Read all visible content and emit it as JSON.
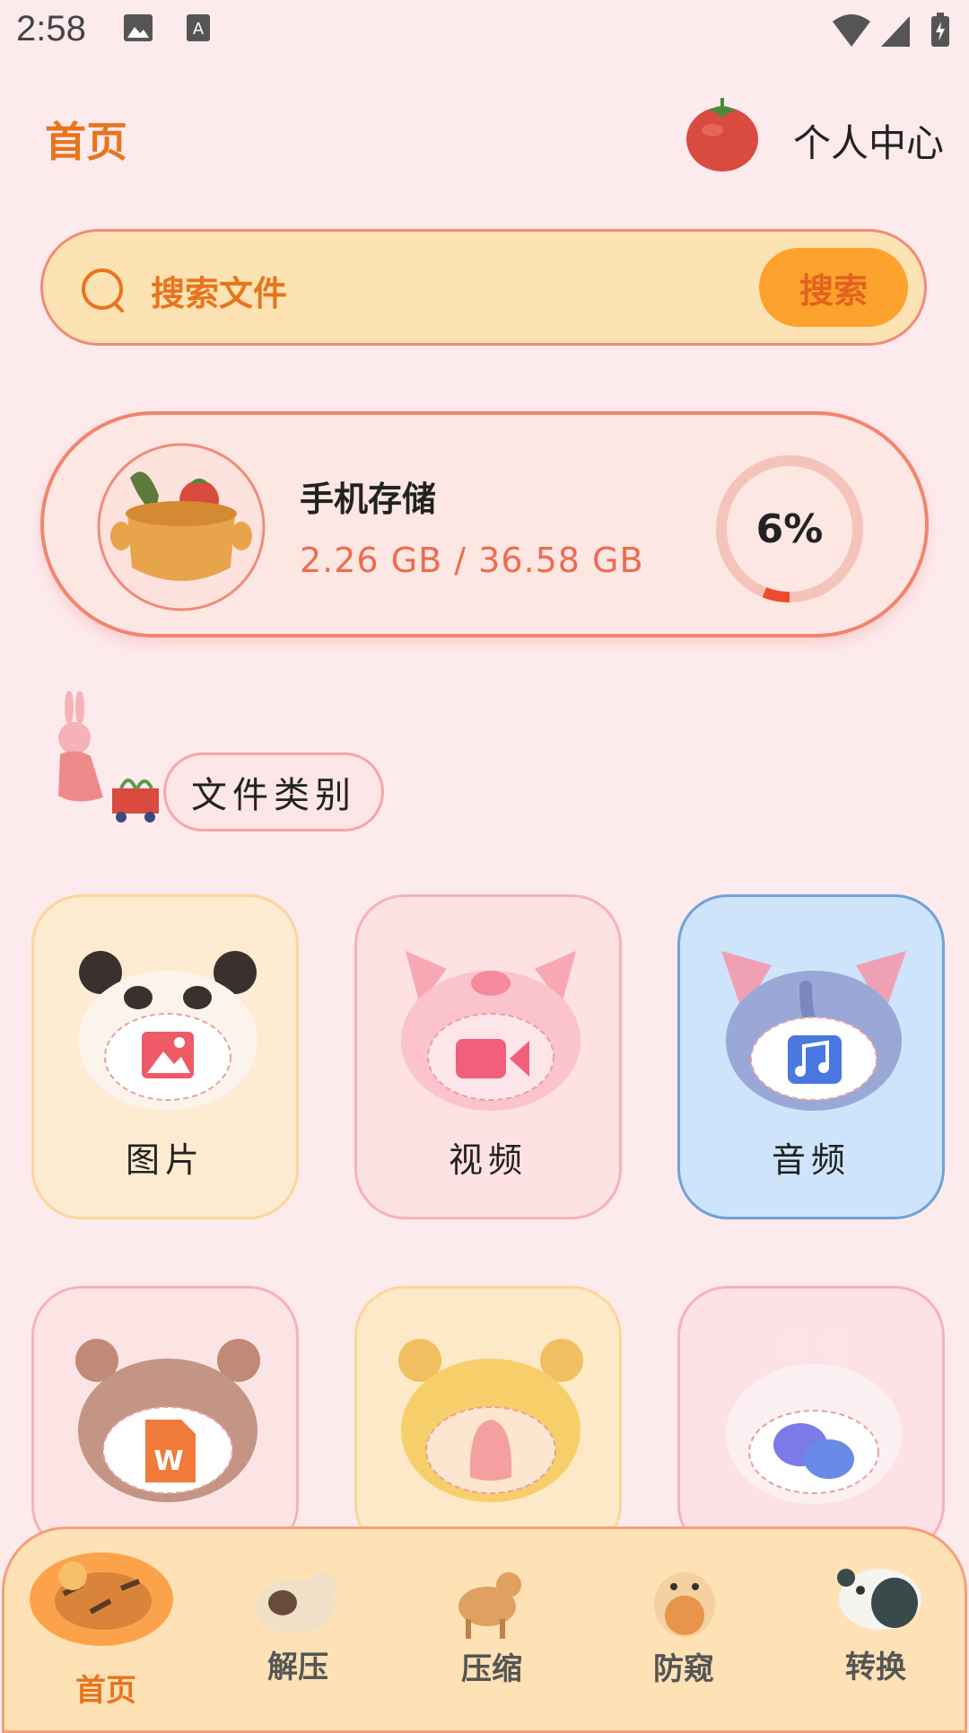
{
  "status_bar": {
    "time": "2:58"
  },
  "header": {
    "title": "首页",
    "profile_label": "个人中心"
  },
  "search": {
    "placeholder": "搜索文件",
    "button_label": "搜索"
  },
  "storage": {
    "title": "手机存储",
    "usage": "2.26 GB / 36.58 GB",
    "percent_label": "6%",
    "percent": 6
  },
  "section": {
    "title": "文件类别"
  },
  "categories": [
    {
      "label": "图片",
      "bg": "#fdebd2",
      "border": "#fcd69a"
    },
    {
      "label": "视频",
      "bg": "#fde1e3",
      "border": "#f5b3b8"
    },
    {
      "label": "音频",
      "bg": "#cde4fb",
      "border": "#6fa2dc"
    },
    {
      "label": "",
      "bg": "#fde4e4",
      "border": "#f5b3b8"
    },
    {
      "label": "",
      "bg": "#fde8c8",
      "border": "#fcd69a"
    },
    {
      "label": "",
      "bg": "#fde1e6",
      "border": "#f5b3b8"
    }
  ],
  "nav": {
    "items": [
      {
        "label": "首页",
        "active": true
      },
      {
        "label": "解压",
        "active": false
      },
      {
        "label": "压缩",
        "active": false
      },
      {
        "label": "防窥",
        "active": false
      },
      {
        "label": "转换",
        "active": false
      }
    ]
  },
  "colors": {
    "accent": "#e8741d",
    "background": "#fdeaed",
    "search_button": "#fda22d",
    "usage_text": "#ef6b4f"
  }
}
